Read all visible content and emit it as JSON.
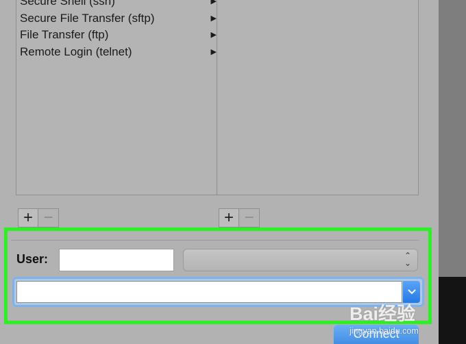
{
  "services": {
    "items": [
      {
        "label": "Secure Shell (ssh)"
      },
      {
        "label": "Secure File Transfer (sftp)"
      },
      {
        "label": "File Transfer (ftp)"
      },
      {
        "label": "Remote Login (telnet)"
      }
    ],
    "submenu_glyph": "▶"
  },
  "list_controls": {
    "add_label": "+",
    "remove_label": "−"
  },
  "connection": {
    "user_label": "User:",
    "user_value": "",
    "user_select_value": "",
    "address_value": "",
    "connect_label": "Connect"
  },
  "watermark": {
    "logo_text": "Bai经验",
    "url_text": "jingyan.baidu.com"
  },
  "colors": {
    "highlight_border": "#2df024",
    "focus_ring": "#7fb2ea",
    "primary_button": "#3984df"
  }
}
